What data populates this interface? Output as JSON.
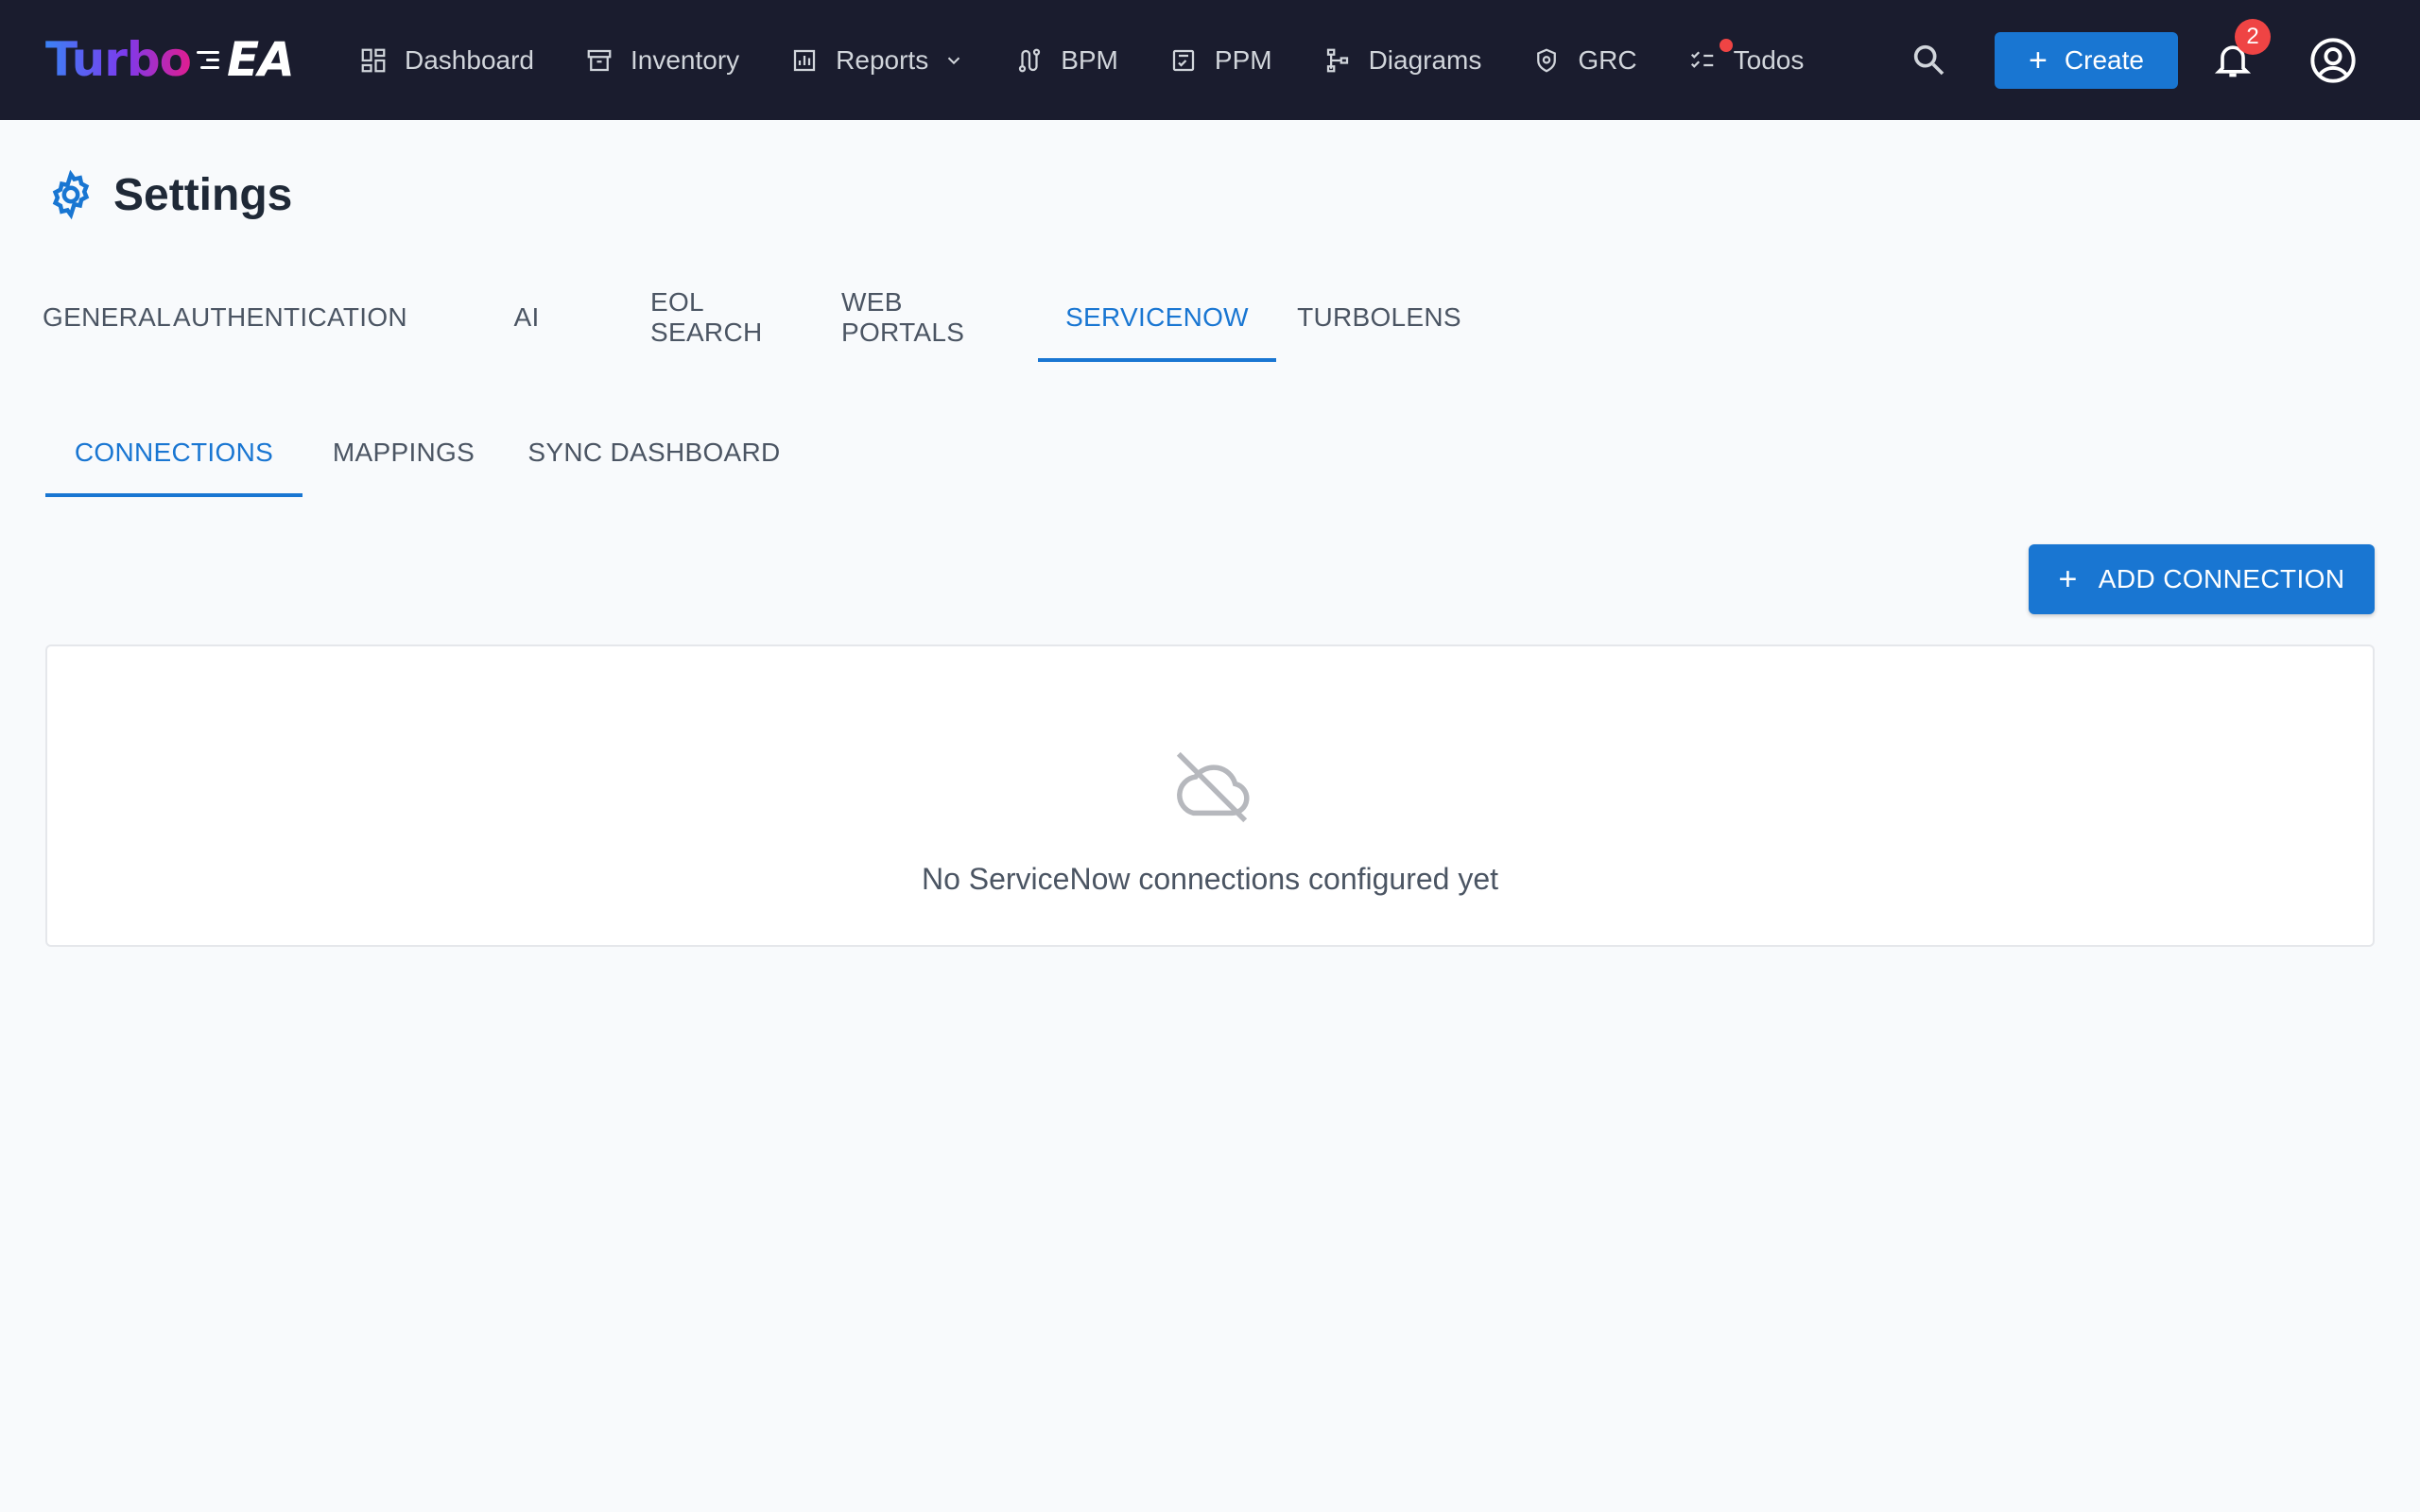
{
  "app": {
    "logo_part1": "Turbo",
    "logo_part2": "EA"
  },
  "nav": {
    "items": [
      {
        "label": "Dashboard",
        "icon": "dashboard-icon"
      },
      {
        "label": "Inventory",
        "icon": "archive-icon"
      },
      {
        "label": "Reports",
        "icon": "chart-icon",
        "has_dropdown": true
      },
      {
        "label": "BPM",
        "icon": "route-icon"
      },
      {
        "label": "PPM",
        "icon": "task-icon"
      },
      {
        "label": "Diagrams",
        "icon": "tree-icon"
      },
      {
        "label": "GRC",
        "icon": "shield-icon"
      },
      {
        "label": "Todos",
        "icon": "checklist-icon",
        "has_dot": true
      }
    ],
    "create_label": "Create",
    "notification_count": "2"
  },
  "page": {
    "title": "Settings",
    "tabs": [
      {
        "label": "GENERAL",
        "active": false
      },
      {
        "label": "AUTHENTICATION",
        "active": false
      },
      {
        "label": "AI",
        "active": false
      },
      {
        "label": "EOL SEARCH",
        "active": false
      },
      {
        "label": "WEB PORTALS",
        "active": false
      },
      {
        "label": "SERVICENOW",
        "active": true
      },
      {
        "label": "TURBOLENS",
        "active": false
      }
    ],
    "subtabs": [
      {
        "label": "CONNECTIONS",
        "active": true
      },
      {
        "label": "MAPPINGS",
        "active": false
      },
      {
        "label": "SYNC DASHBOARD",
        "active": false
      }
    ],
    "add_connection_label": "ADD CONNECTION",
    "empty_message": "No ServiceNow connections configured yet"
  },
  "colors": {
    "topbar": "#1a1c2e",
    "accent": "#1976d2",
    "badge": "#ef4444"
  }
}
